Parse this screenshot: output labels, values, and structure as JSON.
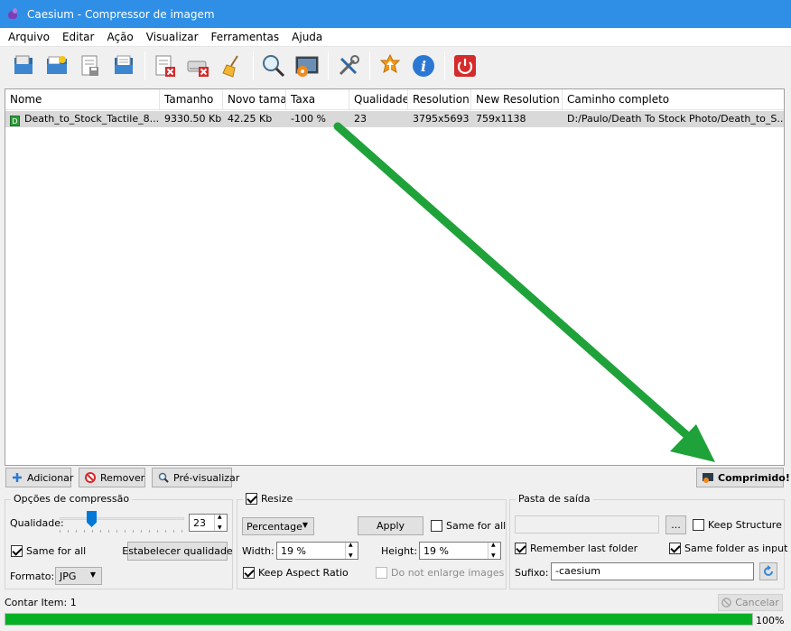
{
  "window": {
    "title": "Caesium - Compressor de imagem"
  },
  "menu": [
    "Arquivo",
    "Editar",
    "Ação",
    "Visualizar",
    "Ferramentas",
    "Ajuda"
  ],
  "toolbar": {
    "icons": [
      "open-file-icon",
      "open-folder-icon",
      "save-list-icon",
      "open-list-icon",
      "remove-item-icon",
      "clear-list-icon",
      "clean-icon",
      "preview-icon",
      "compress-icon",
      "settings-icon",
      "update-icon",
      "info-icon",
      "exit-icon"
    ]
  },
  "table": {
    "headers": [
      "Nome",
      "Tamanho",
      "Novo tamar",
      "Taxa",
      "Qualidade",
      "Resolution",
      "New Resolution",
      "Caminho completo"
    ],
    "rows": [
      {
        "icon_letter": "D",
        "name": "Death_to_Stock_Tactile_8...",
        "size": "9330.50 Kb",
        "new_size": "42.25 Kb",
        "rate": "-100 %",
        "quality": "23",
        "resolution": "3795x5693",
        "new_resolution": "759x1138",
        "path": "D:/Paulo/Death To Stock Photo/Death_to_S..."
      }
    ]
  },
  "actions": {
    "add": "Adicionar",
    "remove": "Remover",
    "preview": "Pré-visualizar",
    "compressed": "Comprimido!"
  },
  "compression": {
    "title": "Opções de compressão",
    "quality_label": "Qualidade:",
    "quality_value": "23",
    "quality_fraction": 0.23,
    "same_for_all": "Same for all",
    "set_quality": "Estabelecer qualidade",
    "format_label": "Formato:",
    "format_value": "JPG"
  },
  "resize": {
    "title": "Resize",
    "mode": "Percentage",
    "apply": "Apply",
    "same_for_all": "Same for all",
    "width_label": "Width:",
    "width_value": "19 %",
    "height_label": "Height:",
    "height_value": "19 %",
    "keep_aspect": "Keep Aspect Ratio",
    "no_enlarge": "Do not enlarge images"
  },
  "output": {
    "title": "Pasta de saída",
    "path_value": "",
    "browse": "...",
    "keep_structure": "Keep Structure",
    "remember_last": "Remember last folder",
    "same_as_input": "Same folder as input",
    "suffix_label": "Sufixo:",
    "suffix_value": "-caesium"
  },
  "status": {
    "count": "Contar Item: 1",
    "cancel": "Cancelar",
    "progress_text": "100%",
    "progress_value": 1.0
  },
  "colors": {
    "titlebar": "#2f8fe6",
    "arrow": "#1fa23a",
    "progress": "#06b025"
  }
}
